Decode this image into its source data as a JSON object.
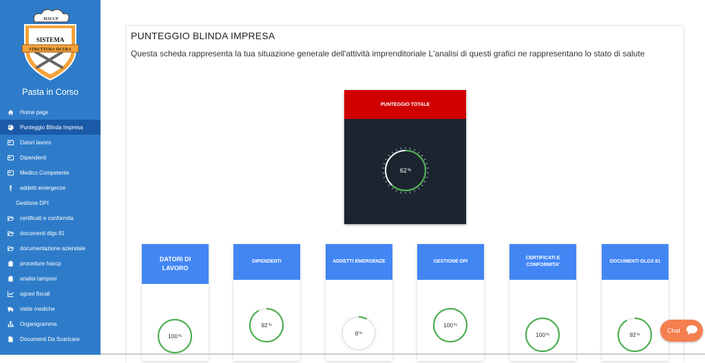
{
  "sidebar": {
    "logo_badge_text": "HACCP",
    "logo_title": "SISTEMA",
    "logo_ribbon": "STRUTTURA SICURA",
    "brand": "Pasta in Corso",
    "items": [
      {
        "label": "Home page",
        "icon": "home-icon",
        "active": false
      },
      {
        "label": "Punteggio Blinda Impresa",
        "icon": "pie-chart-icon",
        "active": true
      },
      {
        "label": "Datori lavoro",
        "icon": "id-card-icon",
        "active": false
      },
      {
        "label": "Dipendenti",
        "icon": "id-card-icon",
        "active": false
      },
      {
        "label": "Medico Competente",
        "icon": "id-card-icon",
        "active": false
      },
      {
        "label": "addetti emergenze",
        "icon": "exclamation-icon",
        "active": false
      },
      {
        "label": "Gestione DPI",
        "icon": "",
        "active": false
      },
      {
        "label": "certificati e conformita",
        "icon": "folder-open-icon",
        "active": false
      },
      {
        "label": "documenti dlgs 81",
        "icon": "folder-open-icon",
        "active": false
      },
      {
        "label": "documentazione aziendale",
        "icon": "folder-open-icon",
        "active": false
      },
      {
        "label": "procedure haccp",
        "icon": "clipboard-icon",
        "active": false
      },
      {
        "label": "analisi tamponi",
        "icon": "clipboard-icon",
        "active": false
      },
      {
        "label": "sgravi fiscali",
        "icon": "line-chart-icon",
        "active": false
      },
      {
        "label": "visite mediche",
        "icon": "truck-icon",
        "active": false
      },
      {
        "label": "Organigramma",
        "icon": "sitemap-icon",
        "active": false
      },
      {
        "label": "Documenti Da Scaricare",
        "icon": "file-icon",
        "active": false
      }
    ]
  },
  "main": {
    "title": "PUNTEGGIO BLINDA IMPRESA",
    "description": "Questa scheda rappresenta la tua situazione generale dell'attività imprenditoriale L'analisi di questi grafici ne rappresentano lo stato di salute",
    "total": {
      "label": "PUNTEGGIO TOTALE",
      "value": "62",
      "unit": "%",
      "percent": 62,
      "color": "#4caf50"
    },
    "cards": [
      {
        "label": "DATORI DI LAVORO",
        "value": "100",
        "unit": "%",
        "percent": 100
      },
      {
        "label": "DIPENDENTI",
        "value": "92",
        "unit": "%",
        "percent": 92
      },
      {
        "label": "ADDETTI EMERGENZE",
        "value": "8",
        "unit": "%",
        "percent": 8
      },
      {
        "label": "GESTIONE DPI",
        "value": "100",
        "unit": "%",
        "percent": 100
      },
      {
        "label": "CERTIFICATI E CONFORMITA'",
        "value": "100",
        "unit": "%",
        "percent": 100
      },
      {
        "label": "DOCUMENTI DLGS 81",
        "value": "92",
        "unit": "%",
        "percent": 92
      }
    ]
  },
  "chat": {
    "label": "Chat"
  },
  "colors": {
    "sidebar": "#2e7cc9",
    "active": "#1b5aa7",
    "card_head": "#4286f4",
    "total_head": "#d10000",
    "gauge": "#4caf50",
    "chat": "#f47f4f"
  }
}
